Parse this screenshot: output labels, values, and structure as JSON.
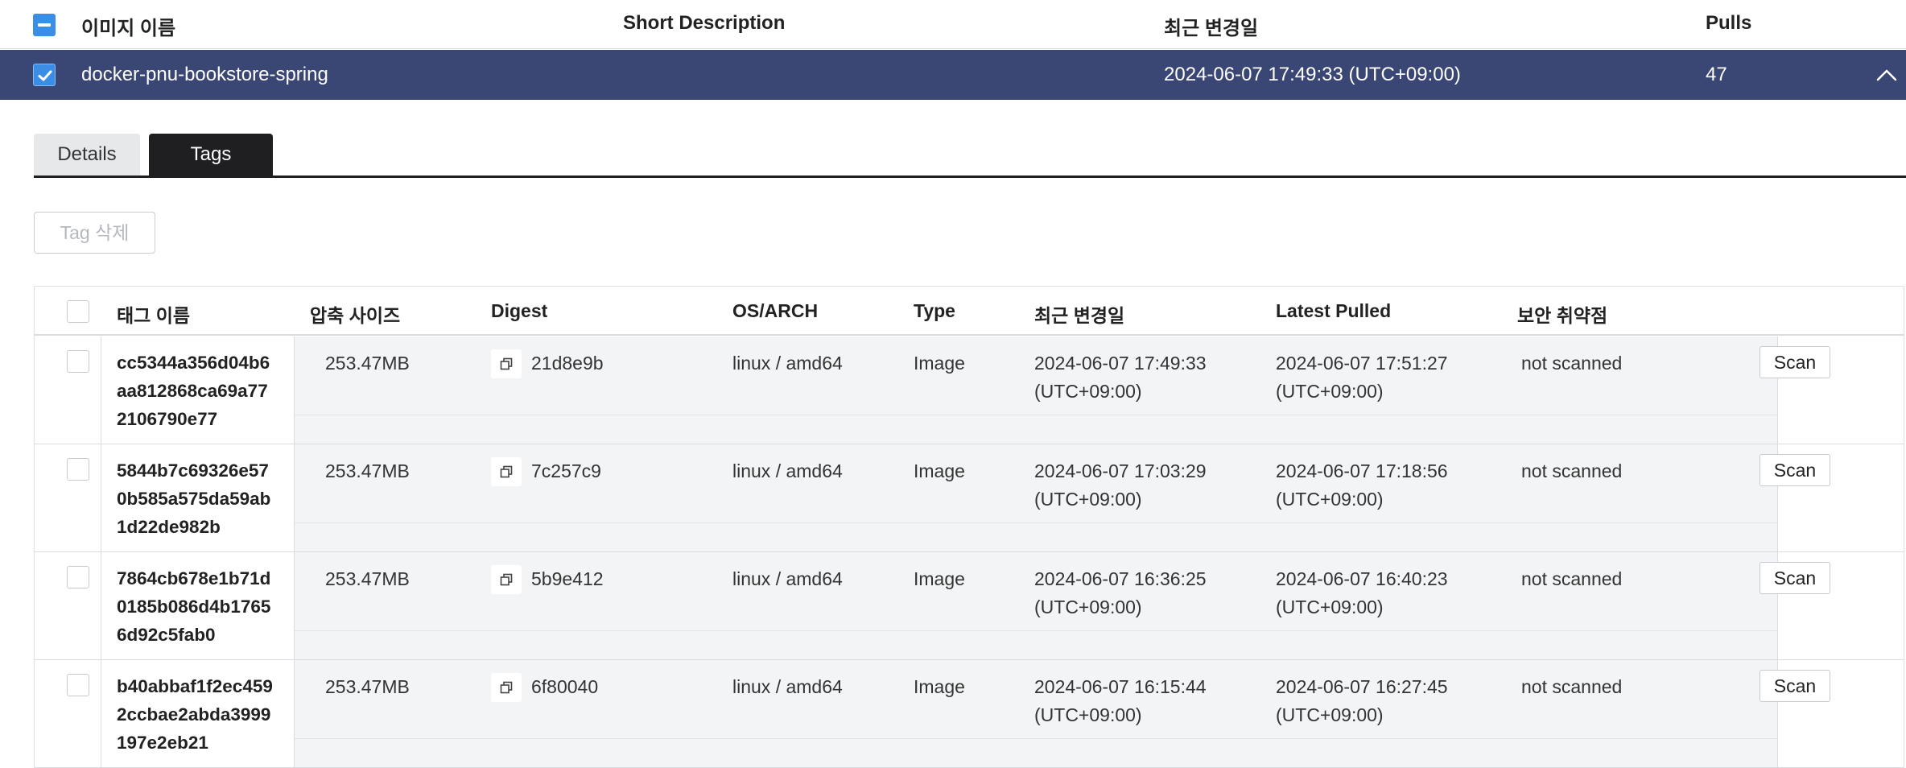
{
  "repo_table": {
    "headers": {
      "image_name": "이미지 이름",
      "short_description": "Short Description",
      "last_modified": "최근 변경일",
      "pulls": "Pulls"
    },
    "selected_row": {
      "name": "docker-pnu-bookstore-spring",
      "short_description": "",
      "last_modified": "2024-06-07 17:49:33 (UTC+09:00)",
      "pulls": "47"
    }
  },
  "tabs": [
    {
      "label": "Details",
      "active": false
    },
    {
      "label": "Tags",
      "active": true
    }
  ],
  "delete_tag_label": "Tag 삭제",
  "tags_table": {
    "headers": {
      "tag_name": "태그 이름",
      "compressed_size": "압축 사이즈",
      "digest": "Digest",
      "os_arch": "OS/ARCH",
      "type": "Type",
      "last_modified": "최근 변경일",
      "latest_pulled": "Latest Pulled",
      "vulnerabilities": "보안 취약점"
    },
    "rows": [
      {
        "tag": "cc5344a356d04b6aa812868ca69a772106790e77",
        "size": "253.47MB",
        "digest": "21d8e9b",
        "os_arch": "linux / amd64",
        "type": "Image",
        "modified_date": "2024-06-07 17:49:33",
        "modified_tz": "(UTC+09:00)",
        "pulled_date": "2024-06-07 17:51:27",
        "pulled_tz": "(UTC+09:00)",
        "security": "not scanned",
        "scan_label": "Scan"
      },
      {
        "tag": "5844b7c69326e570b585a575da59ab1d22de982b",
        "size": "253.47MB",
        "digest": "7c257c9",
        "os_arch": "linux / amd64",
        "type": "Image",
        "modified_date": "2024-06-07 17:03:29",
        "modified_tz": "(UTC+09:00)",
        "pulled_date": "2024-06-07 17:18:56",
        "pulled_tz": "(UTC+09:00)",
        "security": "not scanned",
        "scan_label": "Scan"
      },
      {
        "tag": "7864cb678e1b71d0185b086d4b17656d92c5fab0",
        "size": "253.47MB",
        "digest": "5b9e412",
        "os_arch": "linux / amd64",
        "type": "Image",
        "modified_date": "2024-06-07 16:36:25",
        "modified_tz": "(UTC+09:00)",
        "pulled_date": "2024-06-07 16:40:23",
        "pulled_tz": "(UTC+09:00)",
        "security": "not scanned",
        "scan_label": "Scan"
      },
      {
        "tag": "b40abbaf1f2ec4592ccbae2abda3999197e2eb21",
        "size": "253.47MB",
        "digest": "6f80040",
        "os_arch": "linux / amd64",
        "type": "Image",
        "modified_date": "2024-06-07 16:15:44",
        "modified_tz": "(UTC+09:00)",
        "pulled_date": "2024-06-07 16:27:45",
        "pulled_tz": "(UTC+09:00)",
        "security": "not scanned",
        "scan_label": "Scan"
      }
    ]
  },
  "icons": {
    "select_all": "indeterminate-checkbox-icon",
    "row_checked": "checked-checkbox-icon",
    "collapse": "chevron-up-icon",
    "copy": "copy-icon"
  },
  "colors": {
    "selected_row_bg": "#3a4775",
    "checkbox_blue": "#3b8ee6",
    "active_tab_bg": "#1f1f22",
    "cell_gray_bg": "#f3f4f6"
  }
}
